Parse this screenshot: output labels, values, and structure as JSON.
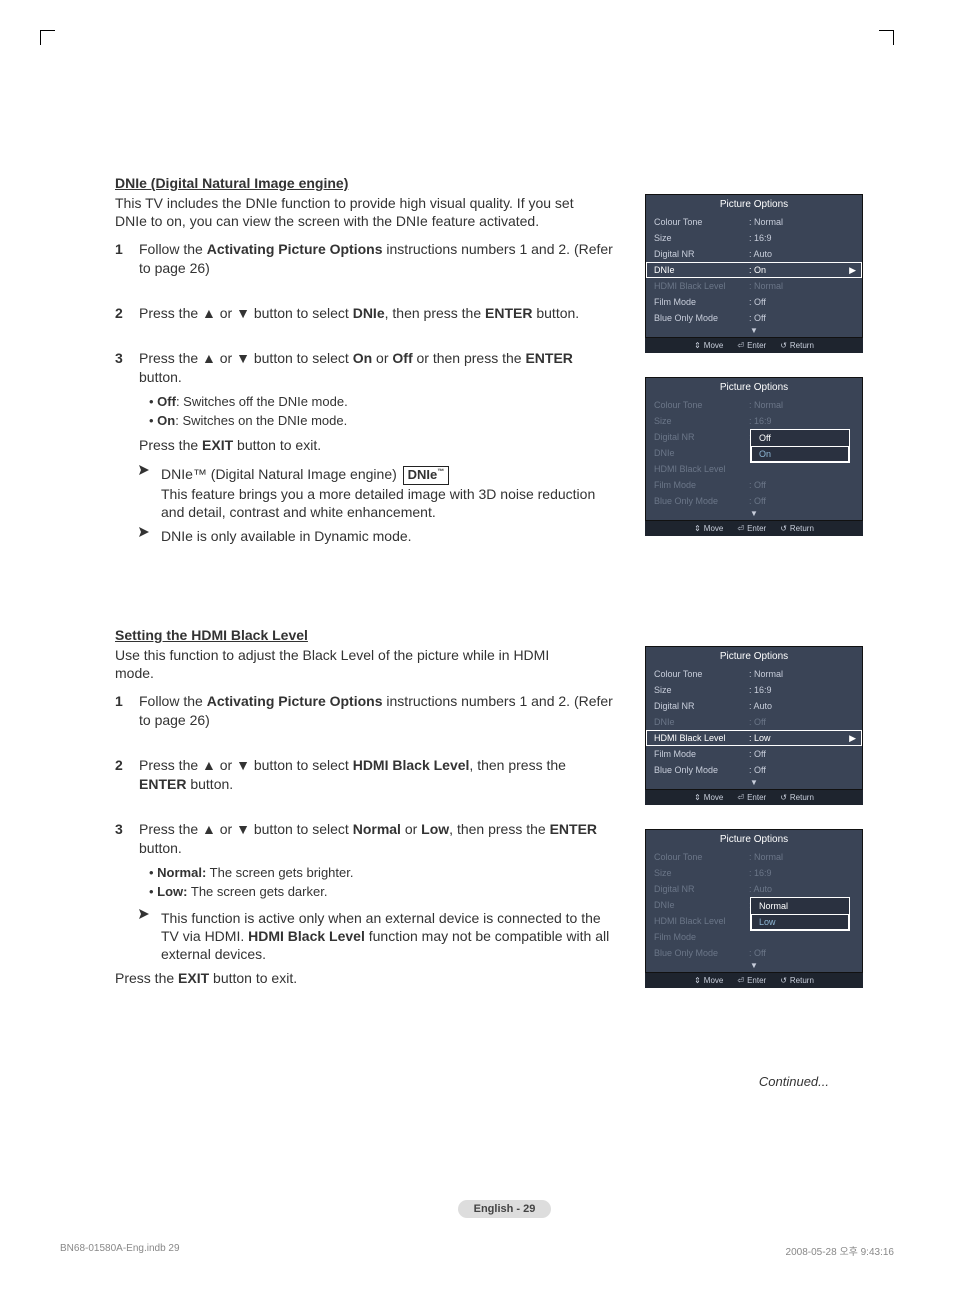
{
  "section1": {
    "heading": "DNIe (Digital Natural Image engine)",
    "intro": "This TV includes the DNIe function to provide high visual quality. If you set DNIe to on, you can view the screen with the DNIe feature activated.",
    "step1_a": "Follow the ",
    "step1_b": "Activating Picture Options",
    "step1_c": " instructions numbers 1 and 2. (Refer to page 26)",
    "step2_a": "Press the ▲ or ▼ button to select ",
    "step2_b": "DNIe",
    "step2_c": ", then press the ",
    "step2_d": "ENTER",
    "step2_e": " button.",
    "step3_a": "Press the ▲ or ▼ button to select ",
    "step3_b": "On",
    "step3_c": " or ",
    "step3_d": "Off",
    "step3_e": " or then press the ",
    "step3_f": "ENTER",
    "step3_g": " button.",
    "bullet_off_b": "Off",
    "bullet_off_t": ": Switches off the DNIe mode.",
    "bullet_on_b": "On",
    "bullet_on_t": ": Switches on the DNIe mode.",
    "exit_a": "Press the ",
    "exit_b": "EXIT",
    "exit_c": " button to exit.",
    "note1_a": "DNIe™ (Digital Natural Image engine) ",
    "note1_logo": "DNIe",
    "note1_tm": "™",
    "note1_b": "This feature brings you a more detailed image with 3D noise reduction and detail, contrast and white enhancement.",
    "note2": "DNIe is only available in Dynamic mode."
  },
  "section2": {
    "heading": "Setting the HDMI Black Level",
    "intro": "Use this function to adjust the Black Level of the picture while in HDMI mode.",
    "step1_a": "Follow the ",
    "step1_b": "Activating Picture Options",
    "step1_c": " instructions numbers 1 and 2. (Refer to page 26)",
    "step2_a": "Press the ▲ or ▼ button to select ",
    "step2_b": "HDMI Black Level",
    "step2_c": ", then press the ",
    "step2_d": "ENTER",
    "step2_e": " button.",
    "step3_a": "Press the ▲ or ▼ button to select ",
    "step3_b": "Normal",
    "step3_c": " or ",
    "step3_d": "Low",
    "step3_e": ", then press the ",
    "step3_f": "ENTER",
    "step3_g": " button.",
    "bullet_normal_b": "Normal:",
    "bullet_normal_t": " The screen gets brighter.",
    "bullet_low_b": "Low:",
    "bullet_low_t": " The screen gets darker.",
    "note1_a": "This function is active only when an external device is connected to the TV via HDMI. ",
    "note1_b": "HDMI Black Level",
    "note1_c": " function may not be compatible with all external devices.",
    "exit_a": "Press the ",
    "exit_b": "EXIT",
    "exit_c": " button to exit."
  },
  "osd": {
    "title": "Picture Options",
    "labels": {
      "colourTone": "Colour Tone",
      "size": "Size",
      "digitalNR": "Digital NR",
      "dnie": "DNIe",
      "hdmiBlack": "HDMI Black Level",
      "filmMode": "Film Mode",
      "blueOnly": "Blue Only Mode"
    },
    "values": {
      "normal": ": Normal",
      "sixteenNine": ": 16:9",
      "auto": ": Auto",
      "on": ": On",
      "off": ": Off",
      "low": ": Low"
    },
    "popup": {
      "off": "Off",
      "on": "On",
      "normal": "Normal",
      "low": "Low"
    },
    "footer": {
      "move": "Move",
      "enter": "Enter",
      "return": "Return"
    },
    "arrows": {
      "right": "▶",
      "down": "▼",
      "updown": "⇕",
      "enter": "⏎",
      "return": "↺"
    }
  },
  "continued": "Continued...",
  "pageFooter": "English - 29",
  "printInfo": {
    "left": "BN68-01580A-Eng.indb   29",
    "right": "2008-05-28   오후 9:43:16"
  }
}
